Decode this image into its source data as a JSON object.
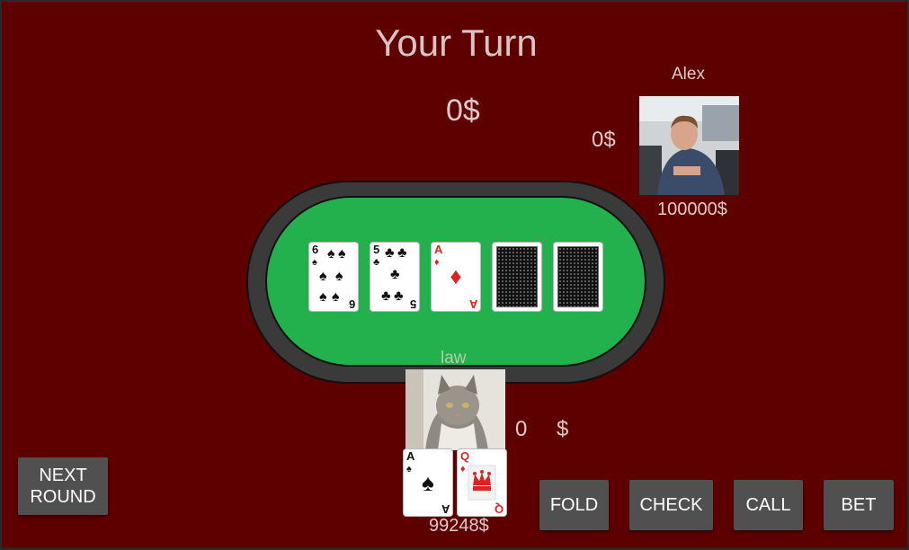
{
  "title": "Your Turn",
  "pot": "0$",
  "opponent": {
    "name": "Alex",
    "bet": "0$",
    "chips": "100000$"
  },
  "player": {
    "name": "law",
    "bet_amount": "0",
    "bet_unit": "$",
    "chips": "99248$",
    "hand": [
      {
        "rank": "A",
        "suit": "♠",
        "color": "black"
      },
      {
        "rank": "Q",
        "suit": "♦",
        "color": "red"
      }
    ]
  },
  "board": [
    {
      "rank": "6",
      "suit": "♠",
      "color": "black"
    },
    {
      "rank": "5",
      "suit": "♣",
      "color": "black"
    },
    {
      "rank": "A",
      "suit": "♦",
      "color": "red"
    },
    {
      "face_down": true
    },
    {
      "face_down": true
    }
  ],
  "buttons": {
    "next_round": "NEXT\nROUND",
    "fold": "FOLD",
    "check": "CHECK",
    "call": "CALL",
    "bet": "BET"
  },
  "colors": {
    "background": "#5e0000",
    "felt": "#22b14c",
    "rim": "#3a3a3a",
    "button": "#505050"
  }
}
